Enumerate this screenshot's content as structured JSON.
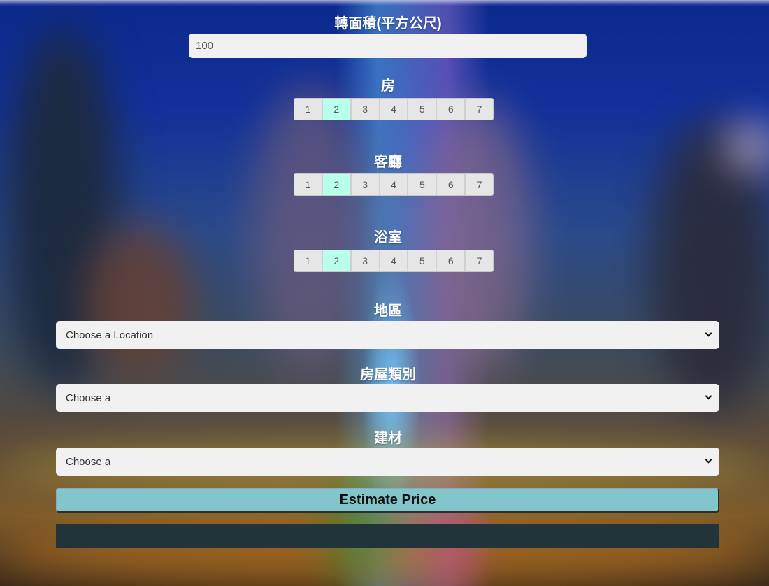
{
  "area": {
    "label": "轉面積(平方公尺)",
    "value": "100"
  },
  "rooms": {
    "label": "房",
    "options": [
      "1",
      "2",
      "3",
      "4",
      "5",
      "6",
      "7"
    ],
    "selected": "2"
  },
  "living": {
    "label": "客廳",
    "options": [
      "1",
      "2",
      "3",
      "4",
      "5",
      "6",
      "7"
    ],
    "selected": "2"
  },
  "bath": {
    "label": "浴室",
    "options": [
      "1",
      "2",
      "3",
      "4",
      "5",
      "6",
      "7"
    ],
    "selected": "2"
  },
  "location": {
    "label": "地區",
    "value": "Choose a Location"
  },
  "house_type": {
    "label": "房屋類別",
    "value": "Choose a"
  },
  "material": {
    "label": "建材",
    "value": "Choose a"
  },
  "estimate_button": "Estimate Price",
  "result_text": ""
}
